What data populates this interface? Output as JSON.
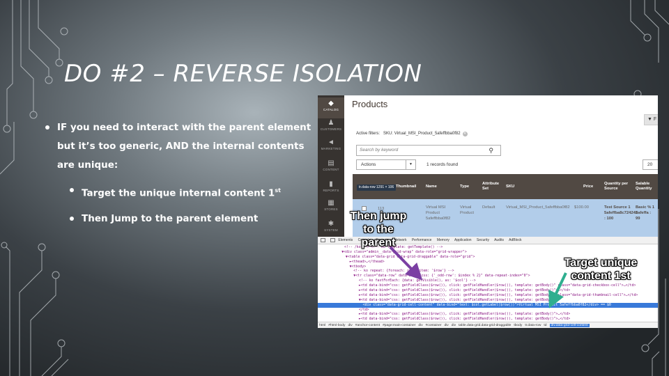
{
  "slide": {
    "title": "DO #2 – REVERSE ISOLATION",
    "bullet_main": "IF you need to interact with the parent element but it’s too generic, AND the internal contents are unique:",
    "sub_bullet_1": "Target the unique internal content 1",
    "sub_bullet_1_sup": "st",
    "sub_bullet_2": "Then Jump to the parent element"
  },
  "callouts": {
    "left": "Then jump\nto the\nparent",
    "right": "Target unique\ncontent 1st"
  },
  "colors": {
    "arrow_purple": "#7b3fa3",
    "arrow_teal": "#2fae8f",
    "admin_sidebar": "#373330",
    "grid_header": "#514943",
    "row_selected": "#b2cdea",
    "devtools_selection": "#3879d9"
  },
  "admin": {
    "nav": [
      {
        "icon": "catalog-icon",
        "glyph": "◆",
        "label": "CATALOG"
      },
      {
        "icon": "customers-icon",
        "glyph": "♟",
        "label": "CUSTOMERS"
      },
      {
        "icon": "marketing-icon",
        "glyph": "◄",
        "label": "MARKETING"
      },
      {
        "icon": "content-icon",
        "glyph": "▤",
        "label": "CONTENT"
      },
      {
        "icon": "reports-icon",
        "glyph": "▮",
        "label": "REPORTS"
      },
      {
        "icon": "stores-icon",
        "glyph": "▦",
        "label": "STORES"
      },
      {
        "icon": "system-icon",
        "glyph": "✱",
        "label": "SYSTEM"
      }
    ],
    "page_title": "Products",
    "filter_button": "F",
    "active_filters_label": "Active filters:",
    "active_filter_value": "SKU: Virtual_MSI_Product_5afeffbba0f82",
    "search_placeholder": "Search by keyword",
    "actions_label": "Actions",
    "records_found": "1 records found",
    "per_page": "20",
    "tooltip": "tr.data-row  1291 × 106",
    "columns": [
      "ID",
      "Thumbnail",
      "Name",
      "Type",
      "Attribute Set",
      "SKU",
      "Price",
      "Quantity per Source",
      "Salable Quantity"
    ],
    "row": {
      "id": "113",
      "name": "Virtual MSI Product 5afeffbba0f82",
      "type": "Virtual Product",
      "attribute_set": "Default",
      "sku": "Virtual_MSI_Product_5afeffbba0f82",
      "price": "$100.00",
      "qty_source": "Test Source 1 5afeffba8c724242 : 100",
      "salable": "Basic % 1 5afeffa : 99"
    }
  },
  "devtools": {
    "tabs": [
      "Elements",
      "Console",
      "Sources",
      "Network",
      "Performance",
      "Memory",
      "Application",
      "Security",
      "Audits",
      "AdBlock"
    ],
    "code_lines": [
      {
        "indent": 20,
        "text": "<!-- /ko --> <!-- ko template: getTemplate() -->"
      },
      {
        "indent": 18,
        "text": "▼<div class=\"admin__data-grid-wrap\" data-role=\"grid-wrapper\">"
      },
      {
        "indent": 21,
        "text": "▼<table class=\"data-grid data-grid-draggable\" data-role=\"grid\">"
      },
      {
        "indent": 24,
        "text": "►<thead>…</thead>"
      },
      {
        "indent": 24,
        "text": "▼<tbody>"
      },
      {
        "indent": 27,
        "text": "<!-- ko repeat: {foreach: rows, item: '$row'} -->"
      },
      {
        "indent": 27,
        "text": "▼<tr class=\"data-row\" data-bind=\"css: {'_odd-row': $index % 2}\" data-repeat-index=\"0\">"
      },
      {
        "indent": 31,
        "text": "<!-- ko fastForEach: {data: getVisible(), as: '$col'} -->"
      },
      {
        "indent": 31,
        "text": "►<td data-bind=\"css: getFieldClass($row()), click: getFieldHandler($row()), template: getBody()\" class=\"data-grid-checkbox-cell\">…</td>"
      },
      {
        "indent": 31,
        "text": "►<td data-bind=\"css: getFieldClass($row()), click: getFieldHandler($row()), template: getBody()\">…</td>"
      },
      {
        "indent": 31,
        "text": "►<td data-bind=\"css: getFieldClass($row()), click: getFieldHandler($row()), template: getBody()\" class=\"data-grid-thumbnail-cell\">…</td>"
      },
      {
        "indent": 31,
        "text": "▼<td data-bind=\"css: getFieldClass($row()), click: getFieldHandler($row()), template: getBody()\">"
      },
      {
        "indent": 34,
        "text": "<div class=\"data-grid-cell-content\" data-bind=\"text: $col.getLabel($row())\">Virtual MSI Product 5afeffbba0f82</div> == $0",
        "selected": true
      },
      {
        "indent": 31,
        "text": "</td>"
      },
      {
        "indent": 31,
        "text": "►<td data-bind=\"css: getFieldClass($row()), click: getFieldHandler($row()), template: getBody()\">…</td>"
      },
      {
        "indent": 31,
        "text": "►<td data-bind=\"css: getFieldClass($row()), click: getFieldHandler($row()), template: getBody()\">…</td>"
      }
    ],
    "breadcrumbs": [
      "html",
      "#html-body",
      "div",
      "#anchor-content",
      "#page:main-container",
      "div",
      "#container",
      "div",
      "div",
      "table.data-grid.data-grid-draggable",
      "tbody",
      "tr.data-row",
      "td",
      "div.data-grid-cell-content"
    ]
  }
}
